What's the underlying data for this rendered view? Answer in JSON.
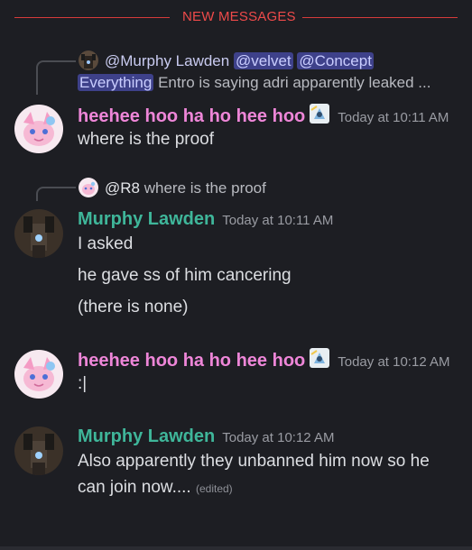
{
  "divider": {
    "label": "NEW MESSAGES",
    "color": "#ee4a4a"
  },
  "replies": [
    {
      "author": "@Murphy Lawden",
      "mentions": [
        "@velvet",
        "@Concept Everything"
      ],
      "mention_a": "@velvet",
      "mention_b_part1": "@Concept",
      "mention_b_part2": "Everything",
      "snippet": "Entro is saying adri apparently leaked ..."
    },
    {
      "author": "@R8",
      "snippet": "where is the proof"
    }
  ],
  "messages": [
    {
      "author": "heehee hoo ha ho hee hoo",
      "author_color": "#ee86d8",
      "timestamp": "Today at 10:11 AM",
      "lines": [
        "where is the proof"
      ],
      "avatar": "pink-sylveon-avatar"
    },
    {
      "author": "Murphy Lawden",
      "author_color": "#3fb69a",
      "timestamp": "Today at 10:11 AM",
      "lines": [
        "I asked",
        "he gave ss of him cancering",
        "(there is none)"
      ],
      "avatar": "robot-avatar"
    },
    {
      "author": "heehee hoo ha ho hee hoo",
      "author_color": "#ee86d8",
      "timestamp": "Today at 10:12 AM",
      "lines": [
        ":|"
      ],
      "avatar": "pink-sylveon-avatar"
    },
    {
      "author": "Murphy Lawden",
      "author_color": "#3fb69a",
      "timestamp": "Today at 10:12 AM",
      "lines": [
        "Also apparently they unbanned him now so he",
        "can join now...."
      ],
      "edited": "(edited)",
      "avatar": "robot-avatar"
    }
  ]
}
